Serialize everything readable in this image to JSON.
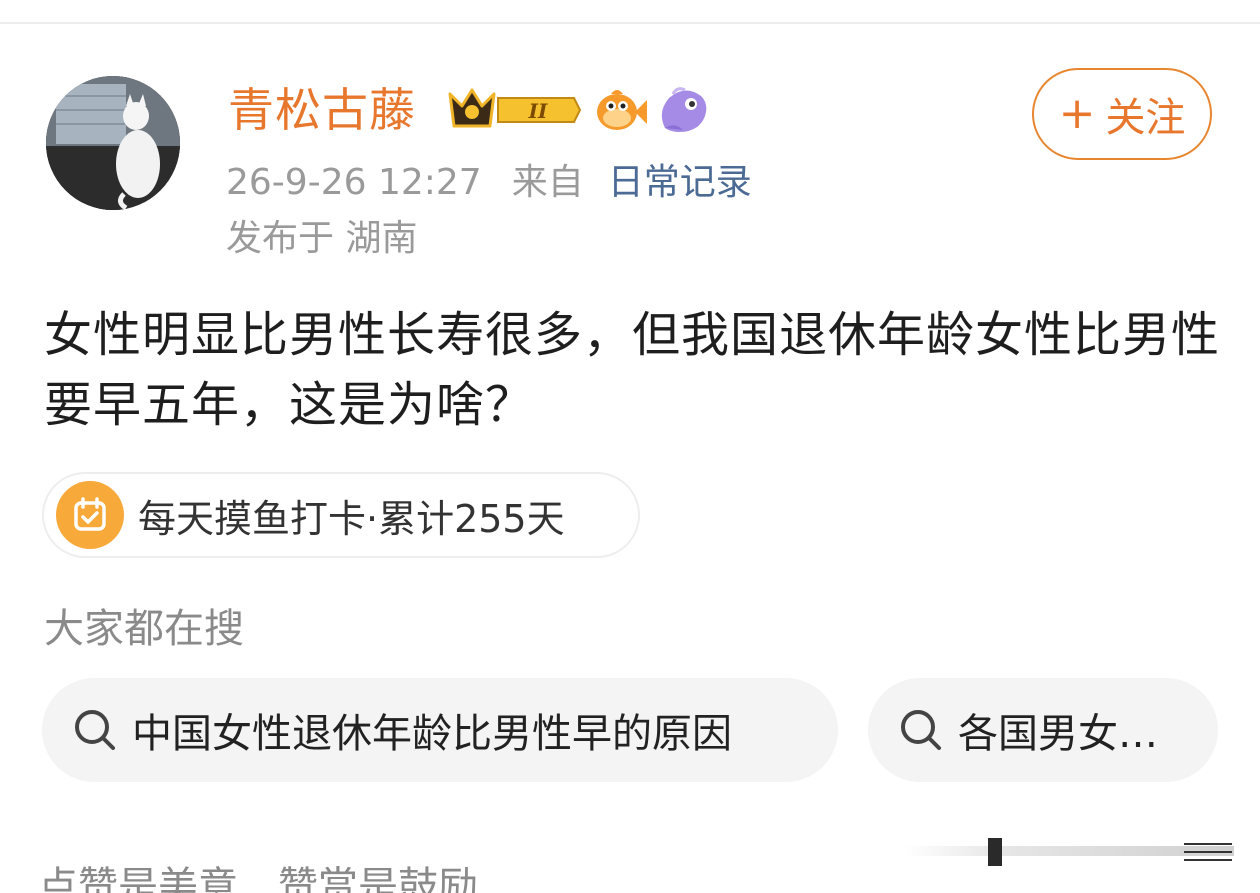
{
  "post": {
    "username": "青松古藤",
    "time": "26-9-26 12:27",
    "from_label": "来自",
    "source": "日常记录",
    "location": "发布于 湖南",
    "follow_label": "关注",
    "text": "女性明显比男性长寿很多，但我国退休年龄女性比男性要早五年，这是为啥？"
  },
  "checkin": {
    "label": "每天摸鱼打卡·累计255天"
  },
  "search": {
    "title": "大家都在搜",
    "chips": [
      {
        "label": "中国女性退休年龄比男性早的原因"
      },
      {
        "label": "各国男女…"
      }
    ]
  },
  "footer": {
    "like_text": "点赞是美意",
    "reward_text": "赞赏是鼓励"
  },
  "badges": {
    "crown_level": "II"
  },
  "colors": {
    "accent": "#e8772e",
    "link": "#4b6a94",
    "muted": "#9a9a9a",
    "chip_bg": "#f4f4f4",
    "checkin_icon": "#f7a93a"
  },
  "icons": [
    "crown-badge-icon",
    "fish-badge-icon",
    "whale-badge-icon",
    "plus-icon",
    "calendar-check-icon",
    "search-icon"
  ]
}
